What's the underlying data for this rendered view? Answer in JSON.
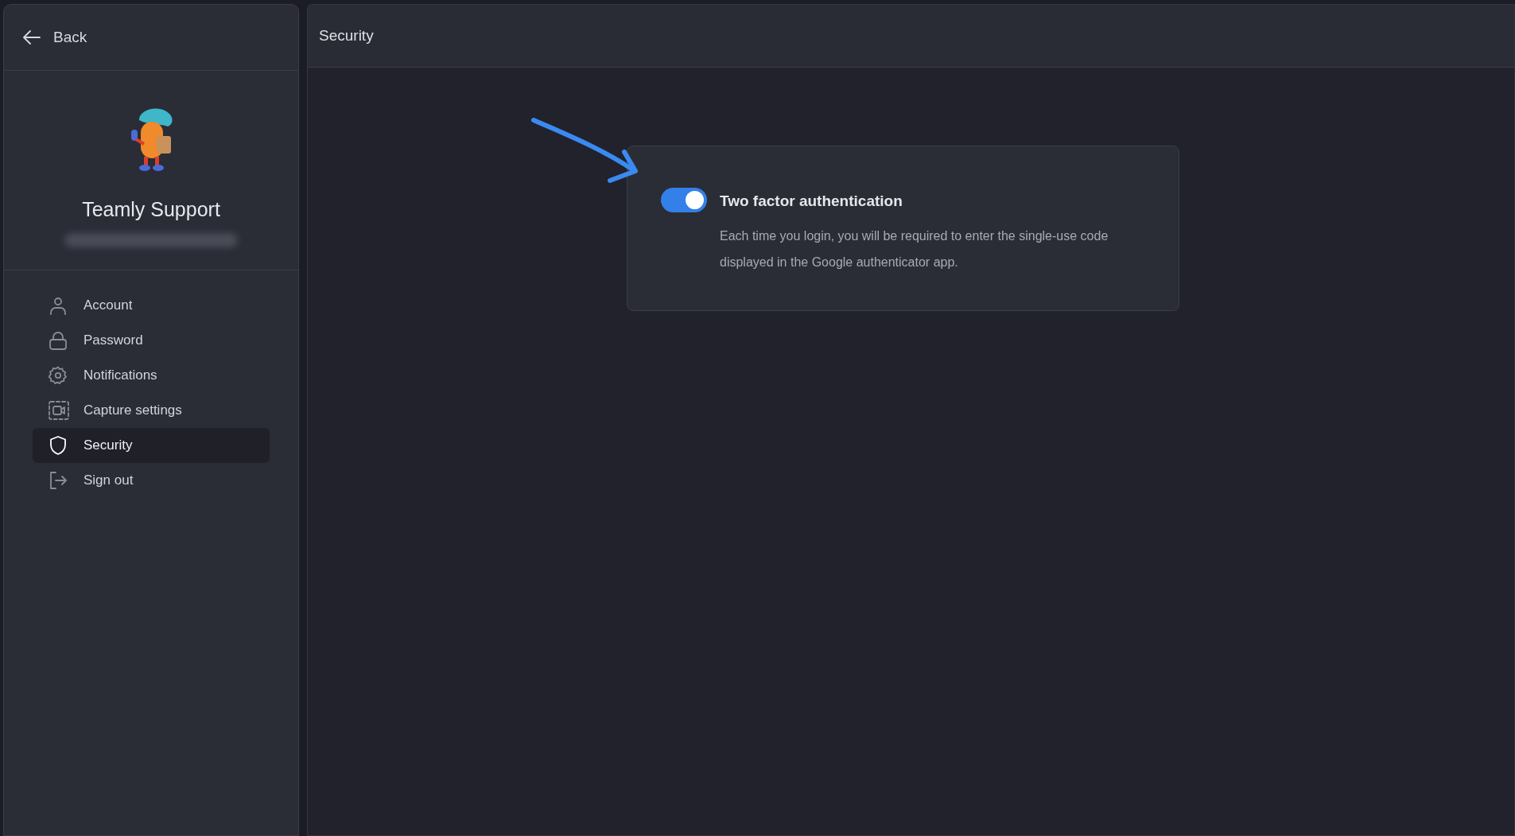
{
  "back": {
    "label": "Back"
  },
  "profile": {
    "name": "Teamly Support",
    "email_redacted": true
  },
  "sidebar": {
    "items": [
      {
        "kind": "person",
        "label": "Account",
        "selected": false
      },
      {
        "kind": "lock",
        "label": "Password",
        "selected": false
      },
      {
        "kind": "gear",
        "label": "Notifications",
        "selected": false
      },
      {
        "kind": "capture",
        "label": "Capture settings",
        "selected": false
      },
      {
        "kind": "shield",
        "label": "Security",
        "selected": true
      },
      {
        "kind": "signout",
        "label": "Sign out",
        "selected": false
      }
    ]
  },
  "header": {
    "title": "Security"
  },
  "setting": {
    "title": "Two factor authentication",
    "on": true,
    "description": "Each time you login, you will be required to enter the single-use code displayed in the Google authenticator app."
  }
}
